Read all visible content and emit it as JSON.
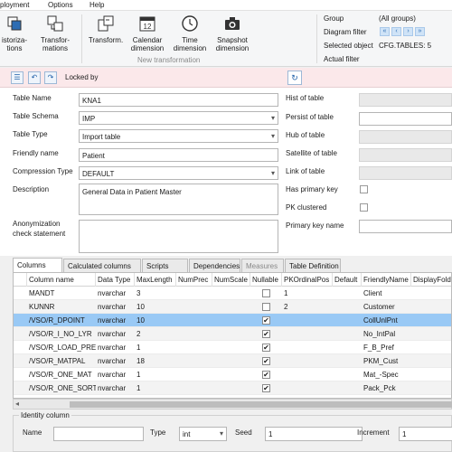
{
  "menu": {
    "items": [
      "ployment",
      "Options",
      "Help"
    ]
  },
  "ribbon": {
    "buttons": [
      {
        "label1": "istoriza-",
        "label2": "tions",
        "icon": "historization-icon"
      },
      {
        "label1": "Transfor-",
        "label2": "mations",
        "icon": "transformations-icon"
      },
      {
        "label1": "Transform.",
        "label2": "",
        "icon": "transform-icon"
      },
      {
        "label1": "Calendar",
        "label2": "dimension",
        "icon": "calendar-icon",
        "badge": "12"
      },
      {
        "label1": "Time",
        "label2": "dimension",
        "icon": "clock-icon"
      },
      {
        "label1": "Snapshot",
        "label2": "dimension",
        "icon": "camera-icon"
      }
    ],
    "group_caption": "New transformation",
    "info": {
      "group_label": "Group",
      "group_value": "(All groups)",
      "diagram_filter_label": "Diagram filter",
      "selected_object_label": "Selected object",
      "selected_object_value": "CFG.TABLES: 5",
      "actual_filter_label": "Actual filter",
      "nav": [
        "«",
        "‹",
        "›",
        "»"
      ]
    }
  },
  "toolbar": {
    "locked_by_label": "Locked by"
  },
  "form": {
    "table_name_label": "Table Name",
    "table_name_value": "KNA1",
    "table_schema_label": "Table Schema",
    "table_schema_value": "IMP",
    "table_type_label": "Table Type",
    "table_type_value": "Import table",
    "friendly_name_label": "Friendly name",
    "friendly_name_value": "Patient",
    "compression_label": "Compression Type",
    "compression_value": "DEFAULT",
    "description_label": "Description",
    "description_value": "General Data in Patient Master",
    "anonymization_label_1": "Anonymization",
    "anonymization_label_2": "check statement",
    "hist_label": "Hist of table",
    "persist_label": "Persist of table",
    "hub_label": "Hub of table",
    "satellite_label": "Satellite of table",
    "link_label": "Link of table",
    "has_pk_label": "Has primary key",
    "pk_clustered_label": "PK clustered",
    "pk_name_label": "Primary key name"
  },
  "tabs": [
    {
      "label": "Columns",
      "state": "active"
    },
    {
      "label": "Calculated columns",
      "state": "normal"
    },
    {
      "label": "Scripts",
      "state": "normal"
    },
    {
      "label": "Dependencies",
      "state": "normal"
    },
    {
      "label": "Measures",
      "state": "disabled"
    },
    {
      "label": "Table Definition",
      "state": "normal"
    }
  ],
  "grid": {
    "headers": [
      "Column name",
      "Data Type",
      "MaxLength",
      "NumPrec",
      "NumScale",
      "Nullable",
      "PKOrdinalPos",
      "Default",
      "FriendlyName",
      "DisplayFolde"
    ],
    "rows": [
      {
        "name": "MANDT",
        "type": "nvarchar",
        "len": "3",
        "nullable": false,
        "pk": "1",
        "friendly": "Client"
      },
      {
        "name": "KUNNR",
        "type": "nvarchar",
        "len": "10",
        "nullable": false,
        "pk": "2",
        "friendly": "Customer"
      },
      {
        "name": "/VSO/R_DPOINT",
        "type": "nvarchar",
        "len": "10",
        "nullable": true,
        "pk": "",
        "friendly": "CollUnlPnt",
        "selected": true
      },
      {
        "name": "/VSO/R_I_NO_LYR",
        "type": "nvarchar",
        "len": "2",
        "nullable": true,
        "pk": "",
        "friendly": "No_IntPal"
      },
      {
        "name": "/VSO/R_LOAD_PREF",
        "type": "nvarchar",
        "len": "1",
        "nullable": true,
        "pk": "",
        "friendly": "F_B_Pref"
      },
      {
        "name": "/VSO/R_MATPAL",
        "type": "nvarchar",
        "len": "18",
        "nullable": true,
        "pk": "",
        "friendly": "PKM_Cust"
      },
      {
        "name": "/VSO/R_ONE_MAT",
        "type": "nvarchar",
        "len": "1",
        "nullable": true,
        "pk": "",
        "friendly": "Mat_-Spec"
      },
      {
        "name": "/VSO/R_ONE_SORT",
        "type": "nvarchar",
        "len": "1",
        "nullable": true,
        "pk": "",
        "friendly": "Pack_Pck"
      }
    ]
  },
  "identity": {
    "title": "Identity column",
    "name_label": "Name",
    "type_label": "Type",
    "type_value": "int",
    "seed_label": "Seed",
    "seed_value": "1",
    "increment_label": "Increment",
    "increment_value": "1"
  },
  "colors": {
    "selected_row": "#99c9f5",
    "toolbar_bg": "#fbe8ea",
    "accent": "#1f5fa8"
  }
}
